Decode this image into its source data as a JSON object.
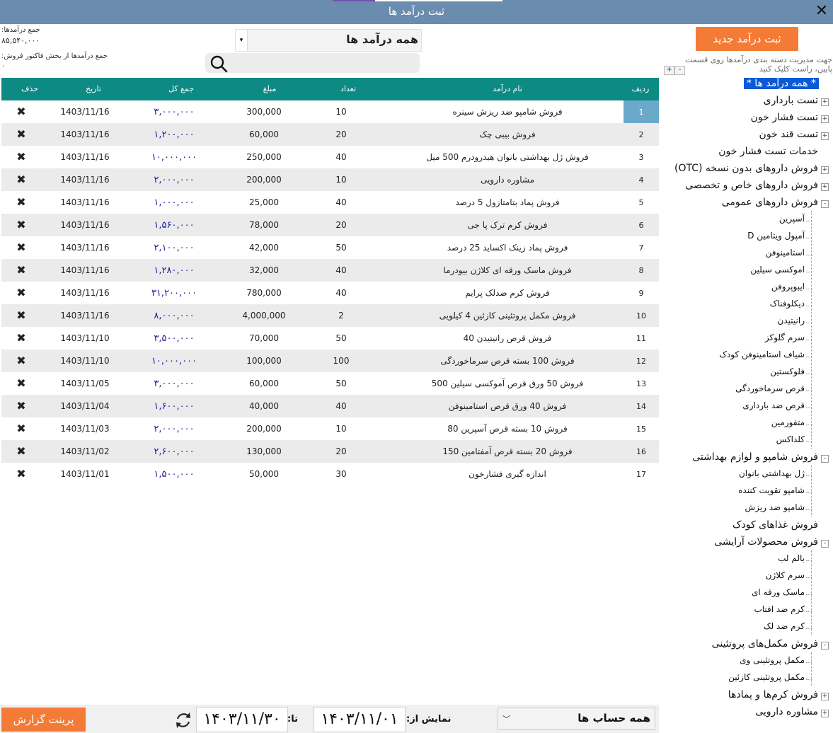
{
  "window": {
    "title": "ثبت درآمد ها"
  },
  "summary": {
    "total_label": "جمع درآمدها:",
    "total_value": "۸۵,۵۴۰,۰۰۰",
    "sales_label": "جمع درآمدها از بخش فاکتور فروش:",
    "sales_value": "۰"
  },
  "filter": {
    "category_value": "همه درآمد ها",
    "search_placeholder": ""
  },
  "actions": {
    "new_income": "ثبت درآمد جدید",
    "print_report": "پرینت گزارش"
  },
  "hint": "جهت مدیریت دسته بندی درآمدها روی قسمت پایین، راست کلیک کنید",
  "grid": {
    "headers": {
      "row": "ردیف",
      "name": "نام درآمد",
      "count": "تعداد",
      "amount": "مبلغ",
      "total": "جمع کل",
      "date": "تاریخ",
      "delete": "حذف"
    },
    "delete_glyph": "✖",
    "rows": [
      {
        "row": "1",
        "name": "فروش شامپو ضد ریزش سینره",
        "count": "10",
        "amount": "300,000",
        "total": "۳,۰۰۰,۰۰۰",
        "date": "1403/11/16"
      },
      {
        "row": "2",
        "name": "فروش بیبی چک",
        "count": "20",
        "amount": "60,000",
        "total": "۱,۲۰۰,۰۰۰",
        "date": "1403/11/16"
      },
      {
        "row": "3",
        "name": "فروش ژل بهداشتی بانوان هیدرودرم 500 میل",
        "count": "40",
        "amount": "250,000",
        "total": "۱۰,۰۰۰,۰۰۰",
        "date": "1403/11/16"
      },
      {
        "row": "4",
        "name": "مشاوره دارویی",
        "count": "10",
        "amount": "200,000",
        "total": "۲,۰۰۰,۰۰۰",
        "date": "1403/11/16"
      },
      {
        "row": "5",
        "name": "فروش پماد بتامتازول 5 درصد",
        "count": "40",
        "amount": "25,000",
        "total": "۱,۰۰۰,۰۰۰",
        "date": "1403/11/16"
      },
      {
        "row": "6",
        "name": "فروش کرم ترک پا جی",
        "count": "20",
        "amount": "78,000",
        "total": "۱,۵۶۰,۰۰۰",
        "date": "1403/11/16"
      },
      {
        "row": "7",
        "name": "فروش پماد زینک اکساید 25 درصد",
        "count": "50",
        "amount": "42,000",
        "total": "۲,۱۰۰,۰۰۰",
        "date": "1403/11/16"
      },
      {
        "row": "8",
        "name": "فروش ماسک ورقه ای کلاژن بیودرما",
        "count": "40",
        "amount": "32,000",
        "total": "۱,۲۸۰,۰۰۰",
        "date": "1403/11/16"
      },
      {
        "row": "9",
        "name": "فروش کرم ضدلک پرایم",
        "count": "40",
        "amount": "780,000",
        "total": "۳۱,۲۰۰,۰۰۰",
        "date": "1403/11/16"
      },
      {
        "row": "10",
        "name": "فروش مکمل پروتئینی کازئین 4 کیلویی",
        "count": "2",
        "amount": "4,000,000",
        "total": "۸,۰۰۰,۰۰۰",
        "date": "1403/11/16"
      },
      {
        "row": "11",
        "name": "فروش قرص رانیتیدن 40",
        "count": "50",
        "amount": "70,000",
        "total": "۳,۵۰۰,۰۰۰",
        "date": "1403/11/10"
      },
      {
        "row": "12",
        "name": "فروش 100 بسته قرص سرماخوردگی",
        "count": "100",
        "amount": "100,000",
        "total": "۱۰,۰۰۰,۰۰۰",
        "date": "1403/11/10"
      },
      {
        "row": "13",
        "name": "فروش 50 ورق قرص آموکسی سیلین 500",
        "count": "50",
        "amount": "60,000",
        "total": "۳,۰۰۰,۰۰۰",
        "date": "1403/11/05"
      },
      {
        "row": "14",
        "name": "فروش 40 ورق قرص استامینوفن",
        "count": "40",
        "amount": "40,000",
        "total": "۱,۶۰۰,۰۰۰",
        "date": "1403/11/04"
      },
      {
        "row": "15",
        "name": "فروش 10 بسته قرص آسپرین 80",
        "count": "10",
        "amount": "200,000",
        "total": "۲,۰۰۰,۰۰۰",
        "date": "1403/11/03"
      },
      {
        "row": "16",
        "name": "فروش 20 بسته قرص آمفتامین 150",
        "count": "20",
        "amount": "130,000",
        "total": "۲,۶۰۰,۰۰۰",
        "date": "1403/11/02"
      },
      {
        "row": "17",
        "name": "اندازه گیری فشارخون",
        "count": "30",
        "amount": "50,000",
        "total": "۱,۵۰۰,۰۰۰",
        "date": "1403/11/01"
      }
    ]
  },
  "tree": {
    "root": "* همه درآمد ها *",
    "nodes": [
      {
        "label": "تست بارداری",
        "expander": "+",
        "children": []
      },
      {
        "label": "تست فشار خون",
        "expander": "+",
        "children": []
      },
      {
        "label": "تست قند خون",
        "expander": "+",
        "children": []
      },
      {
        "label": "خدمات تست فشار خون",
        "expander": "",
        "children": []
      },
      {
        "label": "فروش داروهای بدون نسخه (OTC)",
        "expander": "+",
        "children": []
      },
      {
        "label": "فروش داروهای خاص و تخصصی",
        "expander": "+",
        "children": []
      },
      {
        "label": "فروش داروهای عمومی",
        "expander": "-",
        "children": [
          "آسپرین",
          "آمپول ویتامین D",
          "استامینوفن",
          "اموکسی سیلین",
          "ایبوپروفن",
          "دیکلوفناک",
          "رانیتیدن",
          "سرم گلوکز",
          "شیاف استامینوفن کودک",
          "فلوکستین",
          "قرص سرماخوردگی",
          "قرص ضد بارداری",
          "متفورمین",
          "کلداکس"
        ]
      },
      {
        "label": "فروش شامپو و لوازم بهداشتی",
        "expander": "-",
        "children": [
          "ژل بهداشتی بانوان",
          "شامپو تقویت کننده",
          "شامپو ضد ریزش"
        ]
      },
      {
        "label": "فروش غذاهای کودک",
        "expander": "",
        "children": []
      },
      {
        "label": "فروش محصولات آرایشی",
        "expander": "-",
        "children": [
          "بالم لب",
          "سرم کلاژن",
          "ماسک ورقه ای",
          "کرم ضد افتاب",
          "کرم ضد لک"
        ]
      },
      {
        "label": "فروش مکمل‌های پروتئینی",
        "expander": "-",
        "children": [
          "مکمل پروتئینی وی",
          "مکمل پروتئینی کازئین"
        ]
      },
      {
        "label": "فروش کرم‌ها و پمادها",
        "expander": "+",
        "children": []
      },
      {
        "label": "مشاوره دارویی",
        "expander": "+",
        "children": []
      }
    ]
  },
  "date_filter": {
    "from_label": "نمایش از:",
    "from_value": "۱۴۰۳/۱۱/۰۱",
    "to_label": "تا:",
    "to_value": "۱۴۰۳/۱۱/۳۰"
  },
  "account_filter": {
    "value": "همه حساب ها"
  }
}
